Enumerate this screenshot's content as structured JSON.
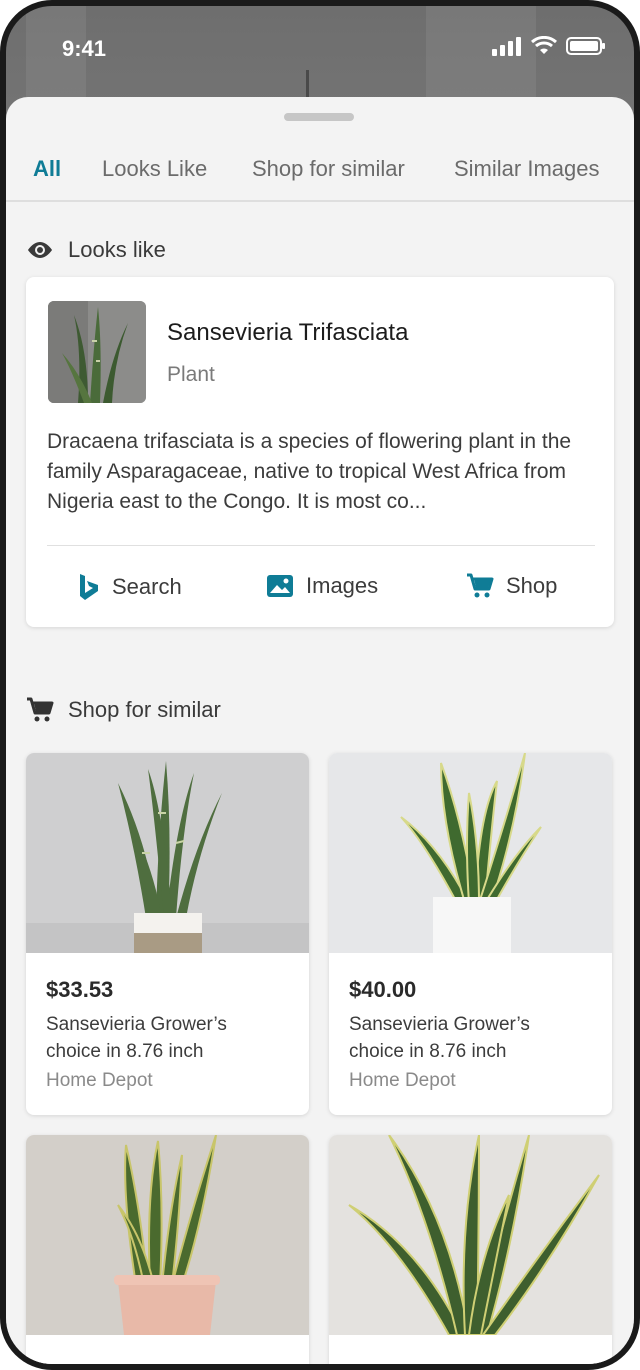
{
  "status_bar": {
    "time": "9:41"
  },
  "tabs": [
    {
      "label": "All",
      "active": true
    },
    {
      "label": "Looks Like",
      "active": false
    },
    {
      "label": "Shop for similar",
      "active": false
    },
    {
      "label": "Similar Images",
      "active": false
    }
  ],
  "looks_like": {
    "heading": "Looks like",
    "icon": "eye-icon",
    "entity": {
      "title": "Sansevieria Trifasciata",
      "subtitle": "Plant",
      "description": "Dracaena trifasciata is a species of flowering plant in the family Asparagaceae, native to tropical West Africa from Nigeria east to the Congo. It is most co..."
    },
    "actions": [
      {
        "label": "Search",
        "icon": "bing-logo-icon"
      },
      {
        "label": "Images",
        "icon": "image-icon"
      },
      {
        "label": "Shop",
        "icon": "cart-icon"
      }
    ]
  },
  "shop_similar": {
    "heading": "Shop for similar",
    "icon": "cart-icon",
    "products": [
      {
        "price": "$33.53",
        "name": "Sansevieria Grower’s choice in 8.76 inch",
        "store": "Home Depot"
      },
      {
        "price": "$40.00",
        "name": "Sansevieria Grower’s choice in 8.76 inch",
        "store": "Home Depot"
      }
    ]
  },
  "colors": {
    "accent": "#0f7c96",
    "sheet_bg": "#f3f3f3",
    "card_bg": "#ffffff"
  }
}
